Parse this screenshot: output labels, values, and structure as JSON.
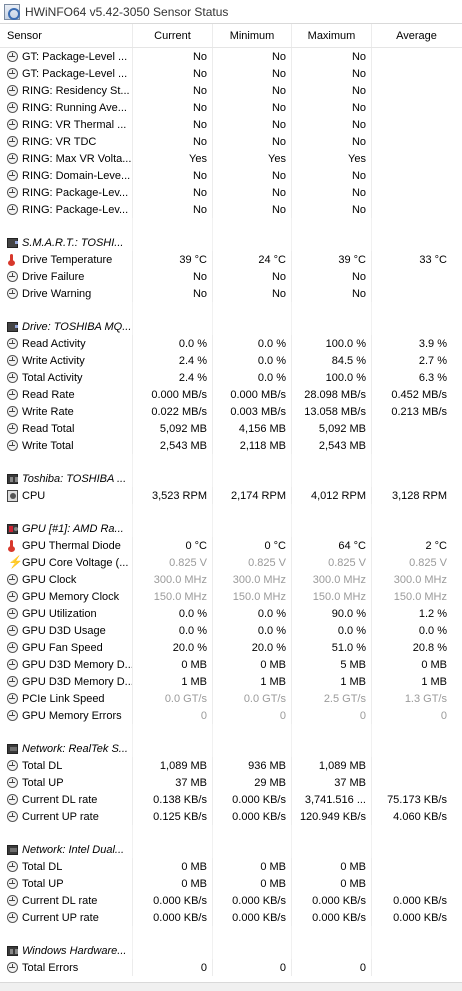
{
  "window": {
    "title": "HWiNFO64 v5.42-3050 Sensor Status"
  },
  "columns": {
    "sensor": "Sensor",
    "current": "Current",
    "minimum": "Minimum",
    "maximum": "Maximum",
    "average": "Average"
  },
  "rows": [
    {
      "kind": "item",
      "icon": "clock-icon",
      "name": "GT: Package-Level ...",
      "current": "No",
      "minimum": "No",
      "maximum": "No",
      "average": ""
    },
    {
      "kind": "item",
      "icon": "clock-icon",
      "name": "GT: Package-Level ...",
      "current": "No",
      "minimum": "No",
      "maximum": "No",
      "average": ""
    },
    {
      "kind": "item",
      "icon": "clock-icon",
      "name": "RING: Residency St...",
      "current": "No",
      "minimum": "No",
      "maximum": "No",
      "average": ""
    },
    {
      "kind": "item",
      "icon": "clock-icon",
      "name": "RING: Running Ave...",
      "current": "No",
      "minimum": "No",
      "maximum": "No",
      "average": ""
    },
    {
      "kind": "item",
      "icon": "clock-icon",
      "name": "RING: VR Thermal ...",
      "current": "No",
      "minimum": "No",
      "maximum": "No",
      "average": ""
    },
    {
      "kind": "item",
      "icon": "clock-icon",
      "name": "RING: VR TDC",
      "current": "No",
      "minimum": "No",
      "maximum": "No",
      "average": ""
    },
    {
      "kind": "item",
      "icon": "clock-icon",
      "name": "RING: Max VR Volta...",
      "current": "Yes",
      "minimum": "Yes",
      "maximum": "Yes",
      "average": ""
    },
    {
      "kind": "item",
      "icon": "clock-icon",
      "name": "RING: Domain-Leve...",
      "current": "No",
      "minimum": "No",
      "maximum": "No",
      "average": ""
    },
    {
      "kind": "item",
      "icon": "clock-icon",
      "name": "RING: Package-Lev...",
      "current": "No",
      "minimum": "No",
      "maximum": "No",
      "average": ""
    },
    {
      "kind": "item",
      "icon": "clock-icon",
      "name": "RING: Package-Lev...",
      "current": "No",
      "minimum": "No",
      "maximum": "No",
      "average": ""
    },
    {
      "kind": "spacer"
    },
    {
      "kind": "group",
      "icon": "drive-icon",
      "name": "S.M.A.R.T.: TOSHI..."
    },
    {
      "kind": "item",
      "icon": "thermometer-icon",
      "name": "Drive Temperature",
      "current": "39 °C",
      "minimum": "24 °C",
      "maximum": "39 °C",
      "average": "33 °C"
    },
    {
      "kind": "item",
      "icon": "clock-icon",
      "name": "Drive Failure",
      "current": "No",
      "minimum": "No",
      "maximum": "No",
      "average": ""
    },
    {
      "kind": "item",
      "icon": "clock-icon",
      "name": "Drive Warning",
      "current": "No",
      "minimum": "No",
      "maximum": "No",
      "average": ""
    },
    {
      "kind": "spacer"
    },
    {
      "kind": "group",
      "icon": "drive-icon",
      "name": "Drive: TOSHIBA MQ..."
    },
    {
      "kind": "item",
      "icon": "clock-icon",
      "name": "Read Activity",
      "current": "0.0 %",
      "minimum": "0.0 %",
      "maximum": "100.0 %",
      "average": "3.9 %"
    },
    {
      "kind": "item",
      "icon": "clock-icon",
      "name": "Write Activity",
      "current": "2.4 %",
      "minimum": "0.0 %",
      "maximum": "84.5 %",
      "average": "2.7 %"
    },
    {
      "kind": "item",
      "icon": "clock-icon",
      "name": "Total Activity",
      "current": "2.4 %",
      "minimum": "0.0 %",
      "maximum": "100.0 %",
      "average": "6.3 %"
    },
    {
      "kind": "item",
      "icon": "clock-icon",
      "name": "Read Rate",
      "current": "0.000 MB/s",
      "minimum": "0.000 MB/s",
      "maximum": "28.098 MB/s",
      "average": "0.452 MB/s"
    },
    {
      "kind": "item",
      "icon": "clock-icon",
      "name": "Write Rate",
      "current": "0.022 MB/s",
      "minimum": "0.003 MB/s",
      "maximum": "13.058 MB/s",
      "average": "0.213 MB/s"
    },
    {
      "kind": "item",
      "icon": "clock-icon",
      "name": "Read Total",
      "current": "5,092 MB",
      "minimum": "4,156 MB",
      "maximum": "5,092 MB",
      "average": ""
    },
    {
      "kind": "item",
      "icon": "clock-icon",
      "name": "Write Total",
      "current": "2,543 MB",
      "minimum": "2,118 MB",
      "maximum": "2,543 MB",
      "average": ""
    },
    {
      "kind": "spacer"
    },
    {
      "kind": "group",
      "icon": "motherboard-icon",
      "name": "Toshiba: TOSHIBA ..."
    },
    {
      "kind": "item",
      "icon": "fan-icon",
      "name": "CPU",
      "current": "3,523 RPM",
      "minimum": "2,174 RPM",
      "maximum": "4,012 RPM",
      "average": "3,128 RPM"
    },
    {
      "kind": "spacer"
    },
    {
      "kind": "group",
      "icon": "gpu-icon",
      "name": "GPU [#1]: AMD Ra..."
    },
    {
      "kind": "item",
      "icon": "thermometer-icon",
      "name": "GPU Thermal Diode",
      "current": "0 °C",
      "minimum": "0 °C",
      "maximum": "64 °C",
      "average": "2 °C"
    },
    {
      "kind": "item",
      "icon": "bolt-icon",
      "name": "GPU Core Voltage (...",
      "current": "0.825 V",
      "minimum": "0.825 V",
      "maximum": "0.825 V",
      "average": "0.825 V",
      "gray": true
    },
    {
      "kind": "item",
      "icon": "clock-icon",
      "name": "GPU Clock",
      "current": "300.0 MHz",
      "minimum": "300.0 MHz",
      "maximum": "300.0 MHz",
      "average": "300.0 MHz",
      "gray": true
    },
    {
      "kind": "item",
      "icon": "clock-icon",
      "name": "GPU Memory Clock",
      "current": "150.0 MHz",
      "minimum": "150.0 MHz",
      "maximum": "150.0 MHz",
      "average": "150.0 MHz",
      "gray": true
    },
    {
      "kind": "item",
      "icon": "clock-icon",
      "name": "GPU Utilization",
      "current": "0.0 %",
      "minimum": "0.0 %",
      "maximum": "90.0 %",
      "average": "1.2 %"
    },
    {
      "kind": "item",
      "icon": "clock-icon",
      "name": "GPU D3D Usage",
      "current": "0.0 %",
      "minimum": "0.0 %",
      "maximum": "0.0 %",
      "average": "0.0 %"
    },
    {
      "kind": "item",
      "icon": "clock-icon",
      "name": "GPU Fan Speed",
      "current": "20.0 %",
      "minimum": "20.0 %",
      "maximum": "51.0 %",
      "average": "20.8 %"
    },
    {
      "kind": "item",
      "icon": "clock-icon",
      "name": "GPU D3D Memory D...",
      "current": "0 MB",
      "minimum": "0 MB",
      "maximum": "5 MB",
      "average": "0 MB"
    },
    {
      "kind": "item",
      "icon": "clock-icon",
      "name": "GPU D3D Memory D...",
      "current": "1 MB",
      "minimum": "1 MB",
      "maximum": "1 MB",
      "average": "1 MB"
    },
    {
      "kind": "item",
      "icon": "clock-icon",
      "name": "PCIe Link Speed",
      "current": "0.0 GT/s",
      "minimum": "0.0 GT/s",
      "maximum": "2.5 GT/s",
      "average": "1.3 GT/s",
      "gray": true
    },
    {
      "kind": "item",
      "icon": "clock-icon",
      "name": "GPU Memory Errors",
      "current": "0",
      "minimum": "0",
      "maximum": "0",
      "average": "0",
      "gray": true
    },
    {
      "kind": "spacer"
    },
    {
      "kind": "group",
      "icon": "network-icon",
      "name": "Network: RealTek S..."
    },
    {
      "kind": "item",
      "icon": "clock-icon",
      "name": "Total DL",
      "current": "1,089 MB",
      "minimum": "936 MB",
      "maximum": "1,089 MB",
      "average": ""
    },
    {
      "kind": "item",
      "icon": "clock-icon",
      "name": "Total UP",
      "current": "37 MB",
      "minimum": "29 MB",
      "maximum": "37 MB",
      "average": ""
    },
    {
      "kind": "item",
      "icon": "clock-icon",
      "name": "Current DL rate",
      "current": "0.138 KB/s",
      "minimum": "0.000 KB/s",
      "maximum": "3,741.516 ...",
      "average": "75.173 KB/s"
    },
    {
      "kind": "item",
      "icon": "clock-icon",
      "name": "Current UP rate",
      "current": "0.125 KB/s",
      "minimum": "0.000 KB/s",
      "maximum": "120.949 KB/s",
      "average": "4.060 KB/s"
    },
    {
      "kind": "spacer"
    },
    {
      "kind": "group",
      "icon": "network-icon",
      "name": "Network: Intel Dual..."
    },
    {
      "kind": "item",
      "icon": "clock-icon",
      "name": "Total DL",
      "current": "0 MB",
      "minimum": "0 MB",
      "maximum": "0 MB",
      "average": ""
    },
    {
      "kind": "item",
      "icon": "clock-icon",
      "name": "Total UP",
      "current": "0 MB",
      "minimum": "0 MB",
      "maximum": "0 MB",
      "average": ""
    },
    {
      "kind": "item",
      "icon": "clock-icon",
      "name": "Current DL rate",
      "current": "0.000 KB/s",
      "minimum": "0.000 KB/s",
      "maximum": "0.000 KB/s",
      "average": "0.000 KB/s"
    },
    {
      "kind": "item",
      "icon": "clock-icon",
      "name": "Current UP rate",
      "current": "0.000 KB/s",
      "minimum": "0.000 KB/s",
      "maximum": "0.000 KB/s",
      "average": "0.000 KB/s"
    },
    {
      "kind": "spacer"
    },
    {
      "kind": "group",
      "icon": "motherboard-icon",
      "name": "Windows Hardware..."
    },
    {
      "kind": "item",
      "icon": "clock-icon",
      "name": "Total Errors",
      "current": "0",
      "minimum": "0",
      "maximum": "0",
      "average": ""
    }
  ]
}
